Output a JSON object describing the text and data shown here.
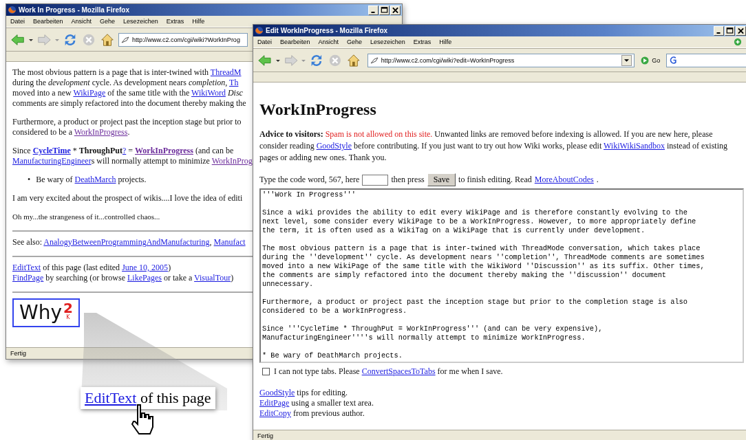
{
  "windows": [
    {
      "title": "Work In Progress - Mozilla Firefox",
      "menu": [
        "Datei",
        "Bearbeiten",
        "Ansicht",
        "Gehe",
        "Lesezeichen",
        "Extras",
        "Hilfe"
      ],
      "url": "http://www.c2.com/cgi/wiki?WorkInProg",
      "blocks": [
        {
          "kind": "p",
          "lines": [
            [
              {
                "kind": "text",
                "t": "The most obvious pattern is a page that is inter-twined with "
              },
              {
                "kind": "link",
                "t": "ThreadM"
              }
            ],
            [
              {
                "kind": "text",
                "t": "during the "
              },
              {
                "kind": "italic",
                "t": "development"
              },
              {
                "kind": "text",
                "t": " cycle. As development nears "
              },
              {
                "kind": "italic",
                "t": "completion"
              },
              {
                "kind": "text",
                "t": ", "
              },
              {
                "kind": "link",
                "t": "Th"
              }
            ],
            [
              {
                "kind": "text",
                "t": "moved into a new "
              },
              {
                "kind": "link",
                "t": "WikiPage"
              },
              {
                "kind": "text",
                "t": " of the same title with the "
              },
              {
                "kind": "link",
                "t": "WikiWord"
              },
              {
                "kind": "italic",
                "t": " Disc"
              }
            ],
            [
              {
                "kind": "text",
                "t": "comments are simply refactored into the document thereby making the"
              }
            ]
          ]
        },
        {
          "kind": "p",
          "lines": [
            [
              {
                "kind": "text",
                "t": "Furthermore, a product or project past the inception stage but prior to"
              }
            ],
            [
              {
                "kind": "text",
                "t": "considered to be a "
              },
              {
                "kind": "visited",
                "t": "WorkInProgress"
              },
              {
                "kind": "text",
                "t": "."
              }
            ]
          ]
        },
        {
          "kind": "p",
          "lines": [
            [
              {
                "kind": "text",
                "t": "Since "
              },
              {
                "kind": "boldlink",
                "t": "CycleTime"
              },
              {
                "kind": "text",
                "t": " * "
              },
              {
                "kind": "bold",
                "t": "ThroughPut"
              },
              {
                "kind": "link",
                "t": "?"
              },
              {
                "kind": "text",
                "t": " = "
              },
              {
                "kind": "boldvisited",
                "t": "WorkInProgress"
              },
              {
                "kind": "text",
                "t": " (and can be"
              }
            ],
            [
              {
                "kind": "link",
                "t": "ManufacturingEngineer"
              },
              {
                "kind": "text",
                "t": "s will normally attempt to minimize "
              },
              {
                "kind": "visited",
                "t": "WorkInProg"
              }
            ]
          ]
        },
        {
          "kind": "li",
          "marker": "•",
          "lines": [
            [
              {
                "kind": "text",
                "t": "Be wary of "
              },
              {
                "kind": "link",
                "t": "DeathMarch"
              },
              {
                "kind": "text",
                "t": " projects."
              }
            ]
          ]
        },
        {
          "kind": "p",
          "lines": [
            [
              {
                "kind": "text",
                "t": "I am very excited about the prospect of wikis....I love the idea of editi"
              }
            ]
          ]
        },
        {
          "kind": "small",
          "lines": [
            [
              {
                "kind": "text",
                "t": "Oh my...the strangeness of it...controlled chaos..."
              }
            ]
          ]
        },
        {
          "kind": "hr"
        },
        {
          "kind": "p",
          "lines": [
            [
              {
                "kind": "text",
                "t": "See also: "
              },
              {
                "kind": "link",
                "t": "AnalogyBetweenProgrammingAndManufacturing"
              },
              {
                "kind": "text",
                "t": ", "
              },
              {
                "kind": "link",
                "t": "Manufact"
              }
            ]
          ]
        },
        {
          "kind": "hr"
        },
        {
          "kind": "p",
          "lines": [
            [
              {
                "kind": "link",
                "t": "EditText"
              },
              {
                "kind": "text",
                "t": " of this page (last edited "
              },
              {
                "kind": "link",
                "t": "June 10, 2005"
              },
              {
                "kind": "text",
                "t": ")"
              }
            ],
            [
              {
                "kind": "link",
                "t": "FindPage"
              },
              {
                "kind": "text",
                "t": " by searching (or browse "
              },
              {
                "kind": "link",
                "t": "LikePages"
              },
              {
                "kind": "text",
                "t": " or take a "
              },
              {
                "kind": "link",
                "t": "VisualTour"
              },
              {
                "kind": "text",
                "t": ")"
              }
            ]
          ]
        },
        {
          "kind": "hr"
        },
        {
          "kind": "logo",
          "text": "Why",
          "sup": "2",
          "sub": "K"
        }
      ],
      "status": "Fertig"
    },
    {
      "title": "Edit WorkInProgress - Mozilla Firefox",
      "menu": [
        "Datei",
        "Bearbeiten",
        "Ansicht",
        "Gehe",
        "Lesezeichen",
        "Extras",
        "Hilfe"
      ],
      "url": "http://www.c2.com/cgi/wiki?edit=WorkInProgress",
      "go_label": "Go",
      "blocks": [
        {
          "kind": "h1",
          "text": "WorkInProgress"
        },
        {
          "kind": "wrap",
          "segments": [
            {
              "kind": "bold",
              "t": "Advice to visitors:"
            },
            {
              "kind": "red",
              "t": " Spam is not allowed on this site."
            },
            {
              "kind": "text",
              "t": " Unwanted links are removed before indexing is allowed. If you are new here, please consider reading "
            },
            {
              "kind": "link",
              "t": "GoodStyle"
            },
            {
              "kind": "text",
              "t": " before contributing. If you just want to try out how Wiki works, please edit "
            },
            {
              "kind": "link",
              "t": "WikiWikiSandbox"
            },
            {
              "kind": "text",
              "t": " instead of existing pages or adding new ones. Thank you."
            }
          ]
        },
        {
          "kind": "form",
          "segments": [
            {
              "kind": "text",
              "t": "Type the code word, 567, here"
            },
            {
              "kind": "input"
            },
            {
              "kind": "text",
              "t": "then press"
            },
            {
              "kind": "button",
              "t": "Save"
            },
            {
              "kind": "text",
              "t": "to finish editing. Read"
            },
            {
              "kind": "link",
              "t": "MoreAboutCodes"
            },
            {
              "kind": "text",
              "t": "."
            }
          ]
        },
        {
          "kind": "textarea",
          "value": "'''Work In Progress'''\n\nSince a wiki provides the ability to edit every WikiPage and is therefore constantly evolving to the\nnext level, some consider every WikiPage to be a WorkInProgress. However, to more appropriately define\nthe term, it is often used as a WikiTag on a WikiPage that is currently under development.\n\nThe most obvious pattern is a page that is inter-twined with ThreadMode conversation, which takes place\nduring the ''development'' cycle. As development nears ''completion'', ThreadMode comments are sometimes\nmoved into a new WikiPage of the same title with the WikiWord ''Discussion'' as its suffix. Other times,\nthe comments are simply refactored into the document thereby making the ''discussion'' document\nunnecessary.\n\nFurthermore, a product or project past the inception stage but prior to the completion stage is also\nconsidered to be a WorkInProgress.\n\nSince '''CycleTime * ThroughPut = WorkInProgress''' (and can be very expensive),\nManufacturingEngineer''''s will normally attempt to minimize WorkInProgress.\n\n* Be wary of DeathMarch projects."
        },
        {
          "kind": "checkbox",
          "checked": false,
          "segments": [
            {
              "kind": "text",
              "t": "I can not type tabs. Please "
            },
            {
              "kind": "link",
              "t": "ConvertSpacesToTabs"
            },
            {
              "kind": "text",
              "t": " for me when I save."
            }
          ]
        },
        {
          "kind": "p",
          "lines": [
            [
              {
                "kind": "link",
                "t": "GoodStyle"
              },
              {
                "kind": "text",
                "t": " tips for editing."
              }
            ],
            [
              {
                "kind": "link",
                "t": "EditPage"
              },
              {
                "kind": "text",
                "t": " using a smaller text area."
              }
            ],
            [
              {
                "kind": "link",
                "t": "EditCopy"
              },
              {
                "kind": "text",
                "t": " from previous author."
              }
            ]
          ]
        }
      ],
      "status": "Fertig"
    }
  ],
  "callout": {
    "segments": [
      {
        "kind": "link",
        "t": "EditText"
      },
      {
        "kind": "text",
        "t": " of this page"
      }
    ]
  }
}
